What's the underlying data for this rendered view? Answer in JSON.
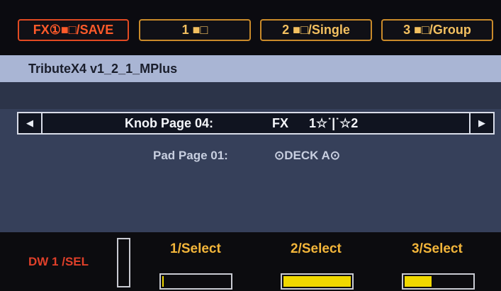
{
  "top_buttons": [
    {
      "label": "FX①■□/SAVE",
      "active": true
    },
    {
      "label": "1 ■□",
      "active": false
    },
    {
      "label": "2 ■□/Single",
      "active": false
    },
    {
      "label": "3 ■□/Group",
      "active": false
    }
  ],
  "title": "TributeX4 v1_2_1_MPlus",
  "knob_row": {
    "left_arrow": "◀",
    "right_arrow": "▶",
    "page_label": "Knob Page 04:",
    "fx_label": "FX",
    "slots_label": "1☆˙|˙☆2"
  },
  "pad_row": {
    "page_label": "Pad Page 01:",
    "deck_label": "⊙DECK A⊙"
  },
  "bottom": {
    "dw_label": "DW 1 /SEL",
    "selectors": [
      {
        "label": "1/Select",
        "level": 0.02
      },
      {
        "label": "2/Select",
        "level": 1.0
      },
      {
        "label": "3/Select",
        "level": 0.4
      }
    ]
  },
  "colors": {
    "accent_orange": "#f3c060",
    "active_red": "#ff5a2a",
    "title_bar": "#a9b5d4",
    "panel": "#36405a",
    "meter_fill": "#f0d800"
  }
}
